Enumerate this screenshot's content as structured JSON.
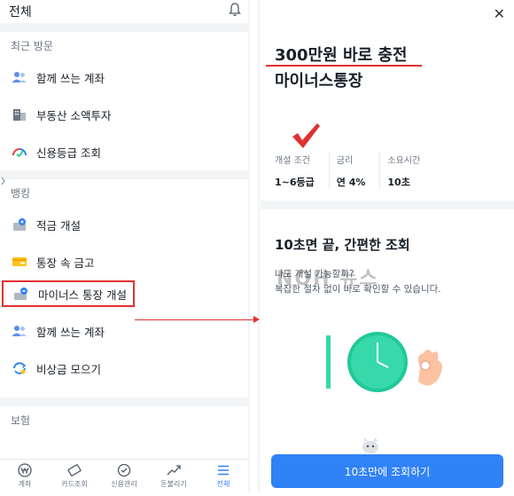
{
  "left": {
    "title": "전체",
    "sections": [
      {
        "title": "최근 방문",
        "items": [
          {
            "label": "함께 쓰는 계좌",
            "icon": "people-icon"
          },
          {
            "label": "부동산 소액투자",
            "icon": "building-icon"
          },
          {
            "label": "신용등급 조회",
            "icon": "gauge-icon"
          }
        ]
      },
      {
        "title": "뱅킹",
        "items": [
          {
            "label": "적금 개설",
            "icon": "savings-icon"
          },
          {
            "label": "통장 속 금고",
            "icon": "safe-icon"
          },
          {
            "label": "마이너스 통장 개설",
            "icon": "minus-account-icon"
          },
          {
            "label": "함께 쓰는 계좌",
            "icon": "people-icon"
          },
          {
            "label": "비상금 모으기",
            "icon": "refresh-coin-icon"
          }
        ]
      },
      {
        "title": "보험",
        "items": []
      }
    ],
    "bottom_nav": [
      {
        "label": "계좌",
        "icon": "won-icon"
      },
      {
        "label": "카드조회",
        "icon": "card-icon"
      },
      {
        "label": "신용관리",
        "icon": "check-shield-icon"
      },
      {
        "label": "돈불리기",
        "icon": "trend-icon"
      },
      {
        "label": "전체",
        "icon": "menu-icon",
        "active": true
      }
    ]
  },
  "right": {
    "promo_line1": "300만원 바로 충전",
    "promo_line2": "마이너스통장",
    "stats": [
      {
        "label": "개설 조건",
        "value": "1~6등급"
      },
      {
        "label": "금리",
        "value": "연 4%"
      },
      {
        "label": "소요시간",
        "value": "10초"
      }
    ],
    "headline": "10초면 끝, 간편한 조회",
    "desc1": "나도 개설 가능할까?",
    "desc2": "복잡한 절차 없이 바로 확인할 수 있습니다.",
    "watermark": "NOH 뉴스",
    "cta_label": "10초만에 조회하기"
  },
  "colors": {
    "accent": "#3182f6",
    "highlight": "#e03131",
    "gap": "#f2f4f6"
  }
}
